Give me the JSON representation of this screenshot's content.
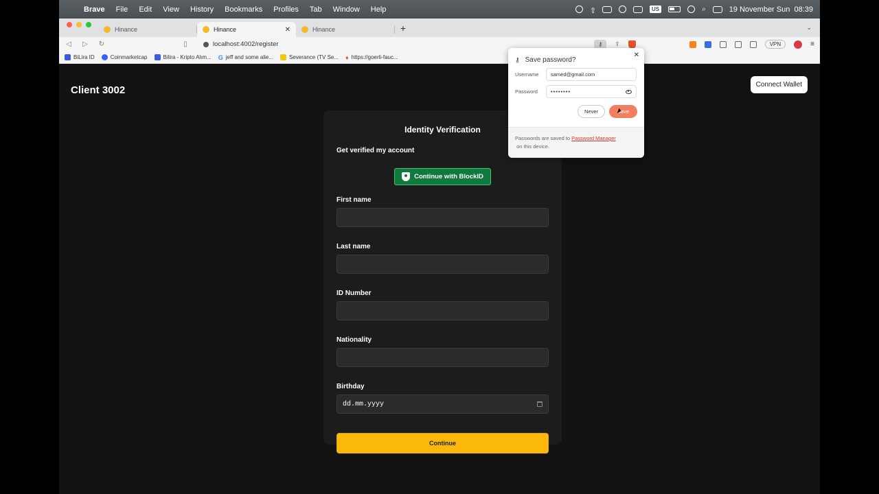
{
  "menubar": {
    "app": "Brave",
    "items": [
      "File",
      "Edit",
      "View",
      "History",
      "Bookmarks",
      "Profiles",
      "Tab",
      "Window",
      "Help"
    ],
    "keyboard": "US",
    "datetime": "19 November Sun  08:39"
  },
  "tabs": [
    {
      "title": "Hinance"
    },
    {
      "title": "Hinance"
    },
    {
      "title": "Hinance"
    }
  ],
  "toolbar": {
    "url": "localhost:4002/register",
    "vpn_label": "VPN"
  },
  "bookmarks": [
    {
      "label": "BiLira ID",
      "color": "#3b5bdb"
    },
    {
      "label": "Coinmarketcap",
      "color": "#3861fb"
    },
    {
      "label": "Bilira - Kripto Alım...",
      "color": "#3b5bdb"
    },
    {
      "label": "jeff and some alie...",
      "color": "#4285f4"
    },
    {
      "label": "Severance (TV Se...",
      "color": "#f5c518"
    },
    {
      "label": "https://goerli-fauc...",
      "color": "#e8553d"
    }
  ],
  "page": {
    "brand": "Client 3002",
    "connect_wallet": "Connect Wallet",
    "card": {
      "title": "Identity Verification",
      "subtitle": "Get verified my account",
      "blockid_button": "Continue with BlockID",
      "fields": [
        {
          "label": "First name",
          "value": ""
        },
        {
          "label": "Last name",
          "value": ""
        },
        {
          "label": "ID Number",
          "value": ""
        },
        {
          "label": "Nationality",
          "value": ""
        },
        {
          "label": "Birthday",
          "value": "dd.mm.yyyy"
        }
      ],
      "continue_button": "Continue"
    }
  },
  "save_password_popup": {
    "title": "Save password?",
    "username_label": "Username",
    "username_value": "samed@gmail.com",
    "password_label": "Password",
    "password_value": "••••••••",
    "never_button": "Never",
    "save_button": "Save",
    "footer_prefix": "Passwords are saved to ",
    "footer_link": "Password Manager",
    "footer_suffix": " on this device."
  },
  "colors": {
    "accent_yellow": "#fcb80b",
    "blockid_green": "#0f7a3d",
    "save_orange": "#f27f5f",
    "tab_favicon": "#f3ba2f"
  }
}
